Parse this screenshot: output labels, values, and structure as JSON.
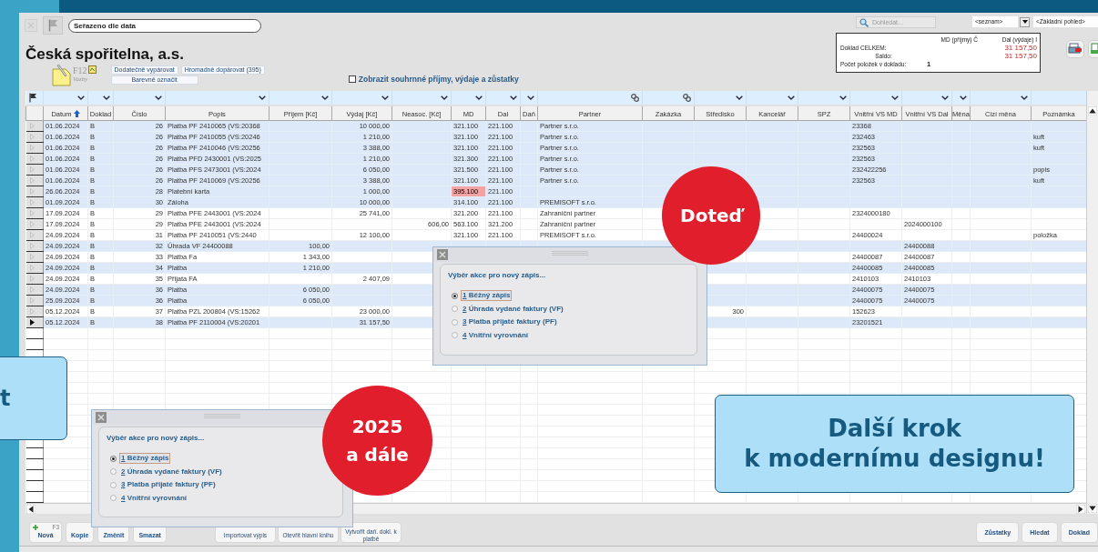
{
  "toolbar": {
    "sort_field": "Seřazeno dle data",
    "search": {
      "placeholder": "Dohledat..."
    },
    "list_select": "<seznam>",
    "view_select": "<Základní pohled>"
  },
  "title": "Česká spořitelna, a.s.",
  "links": {
    "shortcut": "F12",
    "label": "Vazby"
  },
  "actions": [
    {
      "label": "Dodatečně vypárovat"
    },
    {
      "label": "Hromadně dopárovat (395)"
    },
    {
      "label": "Barevně označit"
    }
  ],
  "summary_checkbox": {
    "label": "Zobrazit souhrnné příjmy, výdaje a zůstatky",
    "checked": false
  },
  "summary": {
    "col_md": "MD (příjmy) Č",
    "col_dal": "Dal (výdaje) I",
    "rows": [
      {
        "kind": "total",
        "label": "Doklad CELKEM:",
        "dal": "31 157,50"
      },
      {
        "kind": "balance",
        "label": "Saldo:",
        "dal": "31 157,50"
      },
      {
        "kind": "count",
        "label": "Počet položek v dokladu:",
        "value": "1"
      }
    ]
  },
  "table": {
    "columns": [
      {
        "label": "Datum",
        "kind": "text",
        "sorted": true
      },
      {
        "label": "Doklad",
        "kind": "text",
        "sorted": false
      },
      {
        "label": "Číslo",
        "kind": "amount",
        "sorted": false
      },
      {
        "label": "Popis",
        "kind": "text",
        "sorted": false
      },
      {
        "label": "Příjem [Kč]",
        "kind": "amount",
        "sorted": false
      },
      {
        "label": "Výdaj [Kč]",
        "kind": "amount",
        "sorted": false
      },
      {
        "label": "Neasoc. [Kč]",
        "kind": "amount",
        "sorted": false
      },
      {
        "label": "MD",
        "kind": "text",
        "sorted": false
      },
      {
        "label": "Dal",
        "kind": "text",
        "sorted": false
      },
      {
        "label": "Daň",
        "kind": "text",
        "sorted": false
      },
      {
        "label": "Partner",
        "kind": "linked",
        "sorted": false
      },
      {
        "label": "Zakázka",
        "kind": "linked",
        "sorted": false
      },
      {
        "label": "Středisko",
        "kind": "amount",
        "sorted": false
      },
      {
        "label": "Kancelář",
        "kind": "text",
        "sorted": false
      },
      {
        "label": "SPZ",
        "kind": "text",
        "sorted": false
      },
      {
        "label": "Vnitřní VS MD",
        "kind": "text",
        "sorted": false
      },
      {
        "label": "Vnitřní VS Dal",
        "kind": "text",
        "sorted": false
      },
      {
        "label": "Měna",
        "kind": "text",
        "sorted": false
      },
      {
        "label": "Cizí měna",
        "kind": "text",
        "sorted": false
      },
      {
        "label": "Poznámka",
        "kind": "note",
        "sorted": false
      }
    ],
    "rows": [
      {
        "highlighted": true,
        "current": false,
        "cells": [
          "01.06.2024",
          "B",
          "26",
          "Platba PF 2410065 (VS:20368",
          null,
          "10 000,00",
          null,
          "321.100",
          "221.100",
          null,
          "Partner s.r.o.",
          null,
          null,
          null,
          null,
          "23368",
          null,
          null,
          null,
          null
        ]
      },
      {
        "highlighted": true,
        "current": false,
        "cells": [
          "01.06.2024",
          "B",
          "26",
          "Platba PF 2410055 (VS:20246",
          null,
          "1 210,00",
          null,
          "321.100",
          "221.100",
          null,
          "Partner s.r.o.",
          null,
          null,
          null,
          null,
          "232463",
          null,
          null,
          null,
          "kuft"
        ]
      },
      {
        "highlighted": true,
        "current": false,
        "cells": [
          "01.06.2024",
          "B",
          "26",
          "Platba PF 2410046 (VS:20256",
          null,
          "3 388,00",
          null,
          "321.100",
          "221.100",
          null,
          "Partner s.r.o.",
          null,
          null,
          null,
          null,
          "232563",
          null,
          null,
          null,
          "kuft"
        ]
      },
      {
        "highlighted": true,
        "current": false,
        "cells": [
          "01.06.2024",
          "B",
          "26",
          "Platba PFD 2430001 (VS:2025",
          null,
          "1 210,00",
          null,
          "321.300",
          "221.100",
          null,
          "Partner s.r.o.",
          null,
          null,
          null,
          null,
          "232563",
          null,
          null,
          null,
          null
        ]
      },
      {
        "highlighted": true,
        "current": false,
        "cells": [
          "01.06.2024",
          "B",
          "26",
          "Platba PFS 2473001 (VS:2024",
          null,
          "6 050,00",
          null,
          "321.500",
          "221.100",
          null,
          "Partner s.r.o.",
          null,
          null,
          null,
          null,
          "232422256",
          null,
          null,
          null,
          "popis"
        ]
      },
      {
        "highlighted": true,
        "current": false,
        "cells": [
          "01.06.2024",
          "B",
          "26",
          "Platba PF 2410069 (VS:20256",
          null,
          "3 388,00",
          null,
          "321.100",
          "221.100",
          null,
          "Partner s.r.o.",
          null,
          null,
          null,
          null,
          "232563",
          null,
          null,
          null,
          "kuft"
        ]
      },
      {
        "highlighted": true,
        "current": false,
        "cells": [
          "26.06.2024",
          "B",
          "28",
          "Platební karta",
          null,
          "1 000,00",
          null,
          {
            "text": "395.100",
            "alert": true
          },
          "221.100",
          null,
          null,
          null,
          null,
          null,
          null,
          null,
          null,
          null,
          null,
          null
        ]
      },
      {
        "highlighted": true,
        "current": false,
        "cells": [
          "01.09.2024",
          "B",
          "30",
          "Záloha",
          null,
          "10 000,00",
          null,
          "314.100",
          "221.100",
          null,
          "PREMISOFT s.r.o.",
          null,
          null,
          null,
          null,
          null,
          null,
          null,
          null,
          null
        ]
      },
      {
        "highlighted": false,
        "current": false,
        "cells": [
          "17.09.2024",
          "B",
          "29",
          "Platba PFE 2443001 (VS:2024",
          null,
          "25 741,00",
          null,
          "321.200",
          "221.100",
          null,
          "Zahraniční partner",
          null,
          null,
          null,
          null,
          "2324000180",
          null,
          null,
          null,
          null
        ]
      },
      {
        "highlighted": false,
        "current": false,
        "cells": [
          "17.09.2024",
          "B",
          "29",
          "Platba PFE 2443001 (VS:2024",
          null,
          null,
          "606,00",
          "563.100",
          "321.200",
          null,
          "Zahraniční partner",
          null,
          null,
          null,
          null,
          null,
          "2024000100",
          null,
          null,
          null
        ]
      },
      {
        "highlighted": false,
        "current": false,
        "cells": [
          "24.09.2024",
          "B",
          "31",
          "Platba PF 2410051 (VS:2440",
          null,
          "12 100,00",
          null,
          "321.100",
          "221.100",
          null,
          "PREMISOFT s.r.o.",
          null,
          null,
          null,
          null,
          "24400024",
          null,
          null,
          null,
          "položka"
        ]
      },
      {
        "highlighted": true,
        "current": false,
        "cells": [
          "24.09.2024",
          "B",
          "32",
          "Úhrada VF 24400088",
          "100,00",
          null,
          null,
          null,
          null,
          null,
          null,
          null,
          null,
          null,
          null,
          null,
          "24400088",
          null,
          null,
          null
        ]
      },
      {
        "highlighted": false,
        "current": false,
        "cells": [
          "24.09.2024",
          "B",
          "33",
          "Platba Fa",
          "1 343,00",
          null,
          null,
          null,
          null,
          null,
          null,
          null,
          null,
          null,
          null,
          "24400087",
          "24400087",
          null,
          null,
          null
        ]
      },
      {
        "highlighted": true,
        "current": false,
        "cells": [
          "24.09.2024",
          "B",
          "34",
          "Platba",
          "1 210,00",
          null,
          null,
          null,
          null,
          null,
          null,
          null,
          null,
          null,
          null,
          "24400085",
          "24400085",
          null,
          null,
          null
        ]
      },
      {
        "highlighted": false,
        "current": false,
        "cells": [
          "24.09.2024",
          "B",
          "35",
          "Přijata FA",
          null,
          "2 407,09",
          null,
          null,
          null,
          null,
          null,
          null,
          null,
          null,
          null,
          "2410103",
          "2410103",
          null,
          null,
          null
        ]
      },
      {
        "highlighted": true,
        "current": false,
        "cells": [
          "24.09.2024",
          "B",
          "36",
          "Platba",
          "6 050,00",
          null,
          null,
          null,
          null,
          null,
          null,
          null,
          null,
          null,
          null,
          "24400075",
          "24400075",
          null,
          null,
          null
        ]
      },
      {
        "highlighted": true,
        "current": false,
        "cells": [
          "25.09.2024",
          "B",
          "36",
          "Platba",
          "6 050,00",
          null,
          null,
          null,
          null,
          null,
          null,
          null,
          null,
          null,
          null,
          "24400075",
          "24400075",
          null,
          null,
          null
        ]
      },
      {
        "highlighted": false,
        "current": false,
        "cells": [
          "05.12.2024",
          "B",
          "37",
          "Platba PZL 200804 (VS:15262",
          null,
          "23 000,00",
          null,
          null,
          null,
          null,
          null,
          null,
          "300",
          null,
          null,
          "152623",
          null,
          null,
          null,
          null
        ]
      },
      {
        "highlighted": true,
        "current": true,
        "cells": [
          "05.12.2024",
          "B",
          "38",
          "Platba PF 2110004 (VS:20201",
          null,
          "31 157,50",
          null,
          null,
          null,
          null,
          null,
          null,
          null,
          null,
          null,
          "23201521",
          null,
          null,
          null,
          null
        ]
      }
    ]
  },
  "buttons": [
    {
      "label": "Nová",
      "hint": "F3",
      "kind": "primary"
    },
    {
      "label": "Kopie",
      "kind": "primary"
    },
    {
      "label": "Změnit",
      "kind": "primary"
    },
    {
      "label": "Smazat",
      "kind": "primary"
    },
    {
      "label": "Importovat výpis",
      "kind": "secondary"
    },
    {
      "label": "Otevřít hlavní knihu",
      "kind": "secondary"
    },
    {
      "label": "Vytvořit daň. dokl. k platbě",
      "kind": "secondary"
    }
  ],
  "right_buttons": [
    {
      "label": "Zůstatky"
    },
    {
      "label": "Hledat"
    },
    {
      "label": "Doklad"
    }
  ],
  "dialogs": [
    {
      "heading": "Výběr akce pro nový zápis...",
      "options": [
        {
          "key": "1",
          "text": "Běžný zápis",
          "selected": true
        },
        {
          "key": "2",
          "text": "Úhrada vydané faktury (VF)",
          "selected": false
        },
        {
          "key": "3",
          "text": "Platba přijaté faktury (PF)",
          "selected": false
        },
        {
          "key": "4",
          "text": "Vnitřní vyrovnání",
          "selected": false
        }
      ]
    },
    {
      "heading": "Výběr akce pro nový zápis...",
      "options": [
        {
          "key": "1",
          "text": "Běžný zápis",
          "selected": true
        },
        {
          "key": "2",
          "text": "Úhrada vydané faktury (VF)",
          "selected": false
        },
        {
          "key": "3",
          "text": "Platba přijaté faktury (PF)",
          "selected": false
        },
        {
          "key": "4",
          "text": "Vnitřní vyrovnání",
          "selected": false
        }
      ]
    }
  ],
  "badges": [
    {
      "text": "Doteď"
    },
    {
      "text": "2025\na dále"
    }
  ],
  "callouts": [
    {
      "text": "t"
    },
    {
      "text": "Další krok\nk modernímu designu!"
    }
  ]
}
